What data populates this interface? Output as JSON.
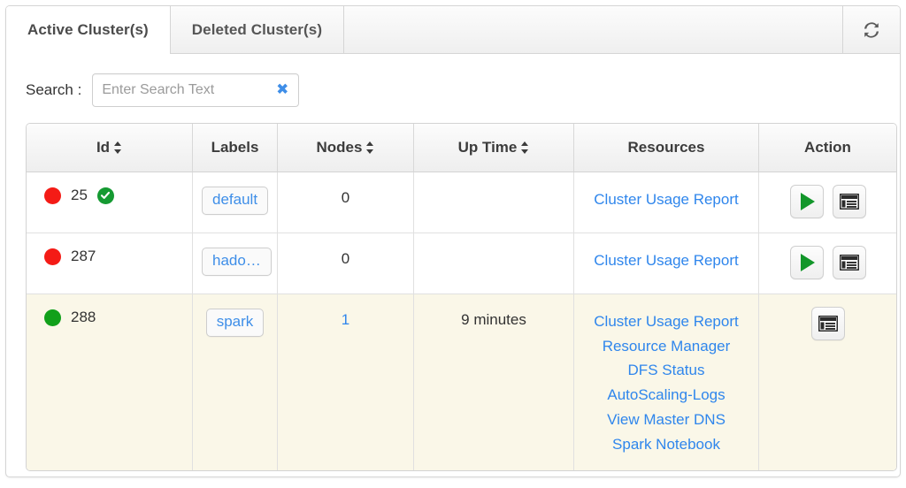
{
  "tabs": [
    {
      "label": "Active Cluster(s)",
      "active": true
    },
    {
      "label": "Deleted Cluster(s)",
      "active": false
    }
  ],
  "refresh": {
    "icon": "refresh-icon",
    "title": "Refresh"
  },
  "search": {
    "label": "Search :",
    "value": "",
    "placeholder": "Enter Search Text",
    "clear_icon": "✖"
  },
  "table": {
    "columns": [
      {
        "label": "Id",
        "sortable": true
      },
      {
        "label": "Labels",
        "sortable": false
      },
      {
        "label": "Nodes",
        "sortable": true
      },
      {
        "label": "Up Time",
        "sortable": true
      },
      {
        "label": "Resources",
        "sortable": false
      },
      {
        "label": "Action",
        "sortable": false
      }
    ],
    "rows": [
      {
        "status": "red",
        "id": "25",
        "verified": true,
        "label": "default",
        "nodes": "0",
        "uptime": "",
        "resources": [
          "Cluster Usage Report"
        ],
        "actions": [
          "start-button",
          "logs-button"
        ],
        "highlight": false
      },
      {
        "status": "red",
        "id": "287",
        "verified": false,
        "label": "hado…",
        "nodes": "0",
        "uptime": "",
        "resources": [
          "Cluster Usage Report"
        ],
        "actions": [
          "start-button",
          "logs-button"
        ],
        "highlight": false
      },
      {
        "status": "green",
        "id": "288",
        "verified": false,
        "label": "spark",
        "nodes": "1",
        "nodes_is_link": true,
        "uptime": "9 minutes",
        "resources": [
          "Cluster Usage Report",
          "Resource Manager",
          "DFS Status",
          "AutoScaling-Logs",
          "View Master DNS",
          "Spark Notebook"
        ],
        "actions": [
          "logs-button"
        ],
        "highlight": true
      }
    ]
  },
  "colors": {
    "link": "#2f86ec",
    "badge_text": "#3e8ee8",
    "status_red": "#f41b16",
    "status_green": "#11a01a",
    "verified_green": "#159a32",
    "play_green": "#12962a",
    "row_highlight": "#faf7e8"
  }
}
